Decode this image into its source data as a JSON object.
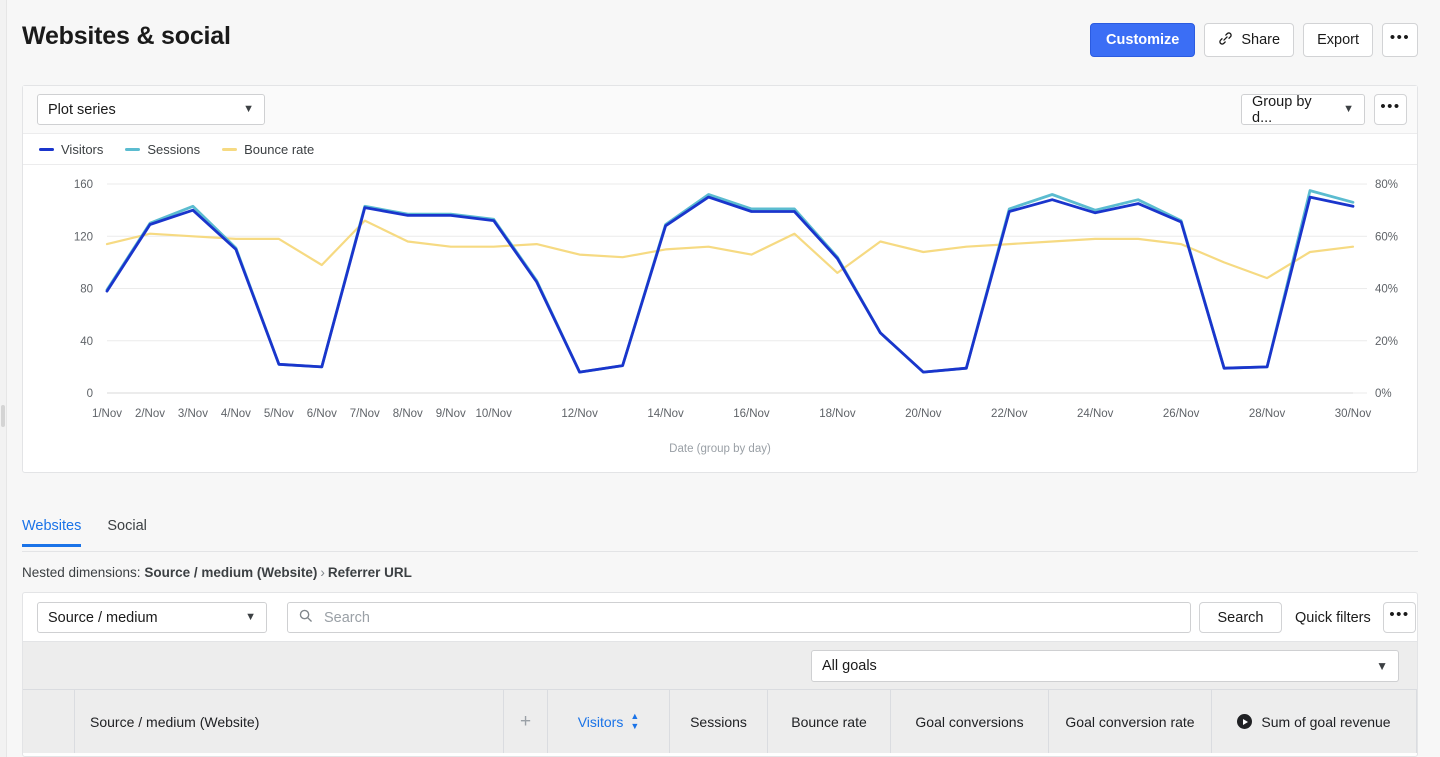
{
  "header": {
    "title": "Websites & social",
    "actions": [
      {
        "label": "Customize",
        "name": "customize-button"
      },
      {
        "label": "Share",
        "name": "share-button",
        "icon": "link-icon"
      },
      {
        "label": "Export",
        "name": "export-button"
      },
      {
        "label": "•••",
        "name": "header-more-button"
      }
    ]
  },
  "chart_card": {
    "plot_series_label": "Plot series",
    "group_by_label": "Group by d...",
    "more_label": "•••"
  },
  "chart_data": {
    "type": "line",
    "title": "",
    "xlabel": "Date (group by day)",
    "ylabel": "",
    "grid": true,
    "legend_position": "top-left",
    "x": [
      "1/Nov",
      "2/Nov",
      "3/Nov",
      "4/Nov",
      "5/Nov",
      "6/Nov",
      "7/Nov",
      "8/Nov",
      "9/Nov",
      "10/Nov",
      "11/Nov",
      "12/Nov",
      "13/Nov",
      "14/Nov",
      "15/Nov",
      "16/Nov",
      "17/Nov",
      "18/Nov",
      "19/Nov",
      "20/Nov",
      "21/Nov",
      "22/Nov",
      "23/Nov",
      "24/Nov",
      "25/Nov",
      "26/Nov",
      "27/Nov",
      "28/Nov",
      "29/Nov",
      "30/Nov"
    ],
    "tick_labels": [
      "1/Nov",
      "2/Nov",
      "3/Nov",
      "4/Nov",
      "5/Nov",
      "6/Nov",
      "7/Nov",
      "8/Nov",
      "9/Nov",
      "10/Nov",
      "",
      "12/Nov",
      "",
      "14/Nov",
      "",
      "16/Nov",
      "",
      "18/Nov",
      "",
      "20/Nov",
      "",
      "22/Nov",
      "",
      "24/Nov",
      "",
      "26/Nov",
      "",
      "28/Nov",
      "",
      "30/Nov"
    ],
    "left_axis": {
      "label": "",
      "ticks": [
        0,
        40,
        80,
        120,
        160
      ],
      "ylim": [
        0,
        170
      ]
    },
    "right_axis": {
      "label": "",
      "ticks": [
        "0%",
        "20%",
        "40%",
        "60%",
        "80%"
      ],
      "ylim": [
        0,
        85
      ]
    },
    "series": [
      {
        "name": "Visitors",
        "color": "#1a35cc",
        "axis": "left",
        "values": [
          78,
          129,
          140,
          110,
          22,
          20,
          142,
          136,
          136,
          132,
          85,
          16,
          21,
          128,
          150,
          139,
          139,
          103,
          46,
          16,
          19,
          139,
          148,
          138,
          145,
          131,
          19,
          20,
          150,
          143
        ]
      },
      {
        "name": "Sessions",
        "color": "#5bbcd0",
        "axis": "left",
        "values": [
          79,
          130,
          143,
          111,
          22,
          20,
          143,
          137,
          137,
          133,
          86,
          16,
          21,
          129,
          152,
          141,
          141,
          104,
          46,
          16,
          19,
          141,
          152,
          140,
          148,
          132,
          19,
          20,
          155,
          146
        ]
      },
      {
        "name": "Bounce rate",
        "color": "#f6da82",
        "axis": "right",
        "values": [
          57,
          61,
          60,
          59,
          59,
          49,
          66,
          58,
          56,
          56,
          57,
          53,
          52,
          55,
          56,
          53,
          61,
          46,
          58,
          54,
          56,
          57,
          58,
          59,
          59,
          57,
          50,
          44,
          54,
          56
        ]
      }
    ]
  },
  "tabs": [
    {
      "label": "Websites",
      "active": true
    },
    {
      "label": "Social",
      "active": false
    }
  ],
  "nested_dimensions": {
    "prefix": "Nested dimensions:",
    "first": "Source / medium (Website)",
    "separator": "›",
    "second": "Referrer URL"
  },
  "table_toolbar": {
    "dimension_value": "Source / medium",
    "search_placeholder": "Search",
    "search_value": "",
    "search_button": "Search",
    "quick_filters_button": "Quick filters",
    "more_label": "•••",
    "all_goals_value": "All goals"
  },
  "table": {
    "columns": [
      "Source / medium (Website)",
      "Visitors",
      "Sessions",
      "Bounce rate",
      "Goal conversions",
      "Goal conversion rate",
      "Sum of goal revenue"
    ],
    "sorted_column": "Visitors",
    "add_column_label": "+"
  },
  "colors": {
    "accent": "#1a73e8",
    "primary_button": "#3b6ef5",
    "visitors": "#1a35cc",
    "sessions": "#5bbcd0",
    "bounce_rate": "#f6da82"
  }
}
